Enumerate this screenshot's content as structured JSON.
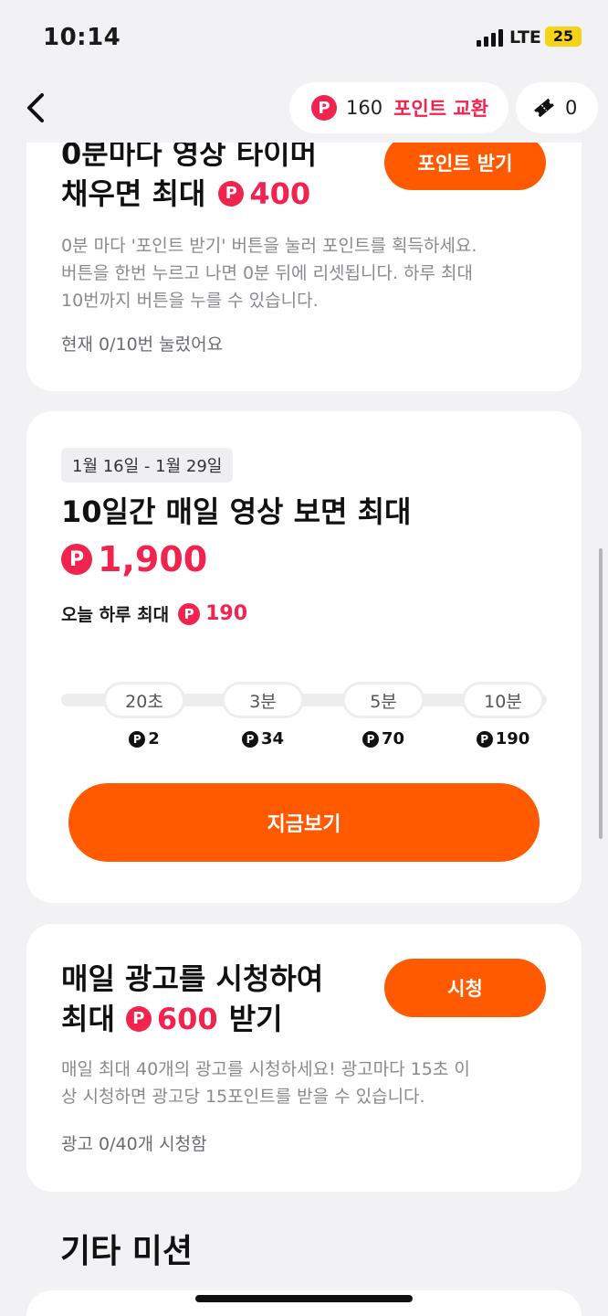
{
  "status": {
    "time": "10:14",
    "network": "LTE",
    "battery": "25"
  },
  "header": {
    "point_symbol": "P",
    "points": "160",
    "exchange_label": "포인트 교환",
    "tickets": "0"
  },
  "card_timer": {
    "title_line1": "0분마다 영상 타이머",
    "title_line2_prefix": "채우면 최대",
    "max_points": "400",
    "button": "포인트 받기",
    "desc_line1": "0분 마다 '포인트 받기' 버튼을 눌러 포인트를 획득하세요.",
    "desc_line2": "버튼을 한번 누르고 나면 0분 뒤에 리셋됩니다. 하루 최대",
    "desc_line3": "10번까지 버튼을 누를 수 있습니다.",
    "status": "현재 0/10번 눌렀어요"
  },
  "card_daily_video": {
    "date_range": "1월 16일 - 1월 29일",
    "title": "10일간 매일 영상 보면 최대",
    "max_points": "1,900",
    "today_prefix": "오늘 하루 최대",
    "today_points": "190",
    "milestones": [
      {
        "time": "20초",
        "reward": "2"
      },
      {
        "time": "3분",
        "reward": "34"
      },
      {
        "time": "5분",
        "reward": "70"
      },
      {
        "time": "10분",
        "reward": "190"
      }
    ],
    "button": "지금보기"
  },
  "card_ads": {
    "title_line1": "매일 광고를 시청하여",
    "title_prefix": "최대",
    "max_points": "600",
    "title_suffix": "받기",
    "button": "시청",
    "desc_line1": "매일 최대 40개의 광고를 시청하세요! 광고마다 15초 이",
    "desc_line2": "상 시청하면 광고당 15포인트를 받을 수 있습니다.",
    "status": "광고 0/40개 시청함"
  },
  "other_missions": {
    "title": "기타 미션"
  },
  "colors": {
    "accent": "#ff5a00",
    "point_red": "#f0244e"
  }
}
